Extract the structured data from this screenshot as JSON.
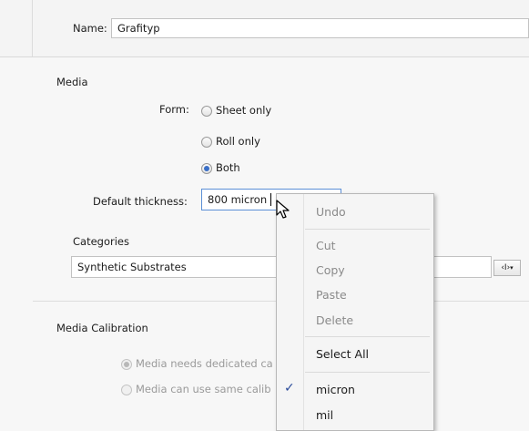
{
  "name": {
    "label": "Name:",
    "value": "Grafityp"
  },
  "media": {
    "section_title": "Media",
    "form_label": "Form:",
    "form_options": [
      {
        "label": "Sheet only",
        "checked": false
      },
      {
        "label": "Roll only",
        "checked": false
      },
      {
        "label": "Both",
        "checked": true
      }
    ],
    "default_thickness_label": "Default thickness:",
    "default_thickness_value": "800 micron",
    "categories_label": "Categories",
    "categories_value": "Synthetic Substrates",
    "categories_button": "‹Ι›"
  },
  "calibration": {
    "section_title": "Media Calibration",
    "options": [
      {
        "label": "Media needs dedicated ca",
        "checked": true
      },
      {
        "label": "Media can use same calib",
        "checked": false
      }
    ]
  },
  "context_menu": {
    "undo": "Undo",
    "cut": "Cut",
    "copy": "Copy",
    "paste": "Paste",
    "delete": "Delete",
    "select_all": "Select All",
    "unit_micron": "micron",
    "unit_mil": "mil",
    "checked_mark": "✓"
  }
}
